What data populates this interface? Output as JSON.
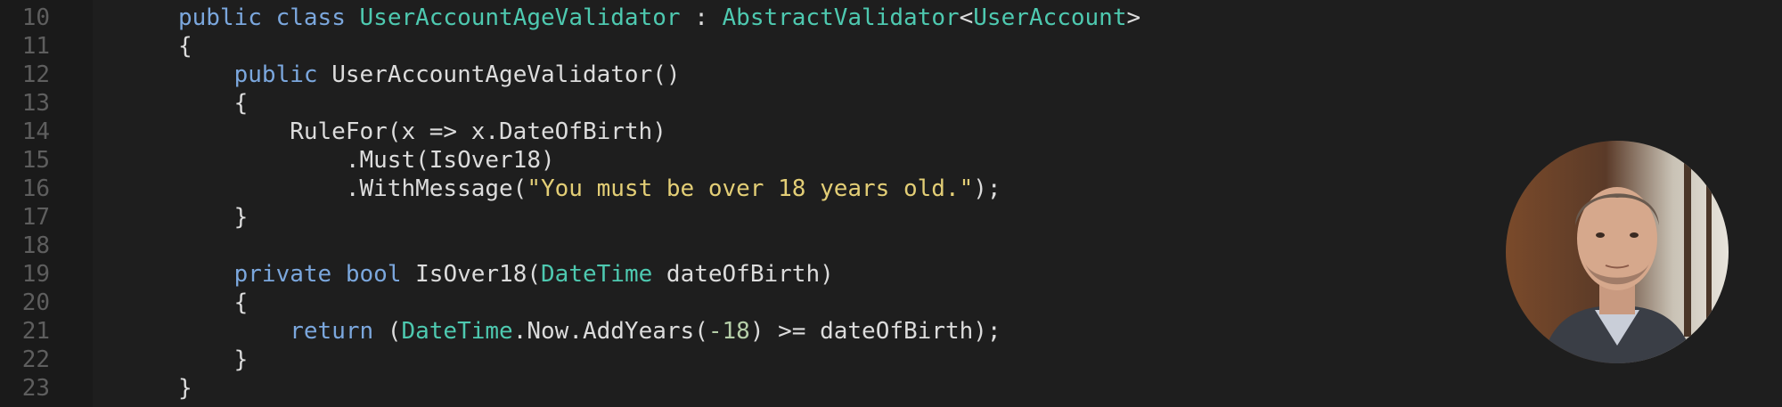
{
  "editor": {
    "lines": [
      {
        "num": "10",
        "tokens": [
          {
            "t": "public",
            "c": "kw"
          },
          {
            "t": " ",
            "c": "punc"
          },
          {
            "t": "class",
            "c": "kw"
          },
          {
            "t": " ",
            "c": "punc"
          },
          {
            "t": "UserAccountAgeValidator",
            "c": "ty"
          },
          {
            "t": " : ",
            "c": "punc"
          },
          {
            "t": "AbstractValidator",
            "c": "ty"
          },
          {
            "t": "<",
            "c": "punc"
          },
          {
            "t": "UserAccount",
            "c": "ty"
          },
          {
            "t": ">",
            "c": "punc"
          }
        ]
      },
      {
        "num": "11",
        "tokens": [
          {
            "t": "{",
            "c": "punc"
          }
        ]
      },
      {
        "num": "12",
        "tokens": [
          {
            "t": "    ",
            "c": "punc"
          },
          {
            "t": "public",
            "c": "kw"
          },
          {
            "t": " UserAccountAgeValidator()",
            "c": "punc"
          }
        ]
      },
      {
        "num": "13",
        "tokens": [
          {
            "t": "    {",
            "c": "punc"
          }
        ]
      },
      {
        "num": "14",
        "tokens": [
          {
            "t": "        RuleFor(x => x.DateOfBirth)",
            "c": "punc"
          }
        ]
      },
      {
        "num": "15",
        "tokens": [
          {
            "t": "            .Must(IsOver18)",
            "c": "punc"
          }
        ]
      },
      {
        "num": "16",
        "tokens": [
          {
            "t": "            .WithMessage(",
            "c": "punc"
          },
          {
            "t": "\"You must be over 18 years old.\"",
            "c": "str"
          },
          {
            "t": ");",
            "c": "punc"
          }
        ]
      },
      {
        "num": "17",
        "tokens": [
          {
            "t": "    }",
            "c": "punc"
          }
        ]
      },
      {
        "num": "18",
        "tokens": [
          {
            "t": "",
            "c": "punc"
          }
        ]
      },
      {
        "num": "19",
        "tokens": [
          {
            "t": "    ",
            "c": "punc"
          },
          {
            "t": "private",
            "c": "kw"
          },
          {
            "t": " ",
            "c": "punc"
          },
          {
            "t": "bool",
            "c": "kw"
          },
          {
            "t": " IsOver18(",
            "c": "punc"
          },
          {
            "t": "DateTime",
            "c": "ty"
          },
          {
            "t": " dateOfBirth)",
            "c": "punc"
          }
        ]
      },
      {
        "num": "20",
        "tokens": [
          {
            "t": "    {",
            "c": "punc"
          }
        ]
      },
      {
        "num": "21",
        "tokens": [
          {
            "t": "        ",
            "c": "punc"
          },
          {
            "t": "return",
            "c": "kw"
          },
          {
            "t": " (",
            "c": "punc"
          },
          {
            "t": "DateTime",
            "c": "ty"
          },
          {
            "t": ".Now.AddYears(",
            "c": "punc"
          },
          {
            "t": "-18",
            "c": "num"
          },
          {
            "t": ") >= dateOfBirth);",
            "c": "punc"
          }
        ]
      },
      {
        "num": "22",
        "tokens": [
          {
            "t": "    }",
            "c": "punc"
          }
        ]
      },
      {
        "num": "23",
        "tokens": [
          {
            "t": "}",
            "c": "punc"
          }
        ]
      }
    ]
  },
  "presenter": {
    "icon": "presenter-photo"
  },
  "colors": {
    "background": "#1e1e1e",
    "keyword": "#7ba7dd",
    "type": "#4ec9b0",
    "string": "#e3ce76",
    "number": "#b5cea8",
    "text": "#dcdcdc",
    "line_number": "#5e5e5e"
  }
}
